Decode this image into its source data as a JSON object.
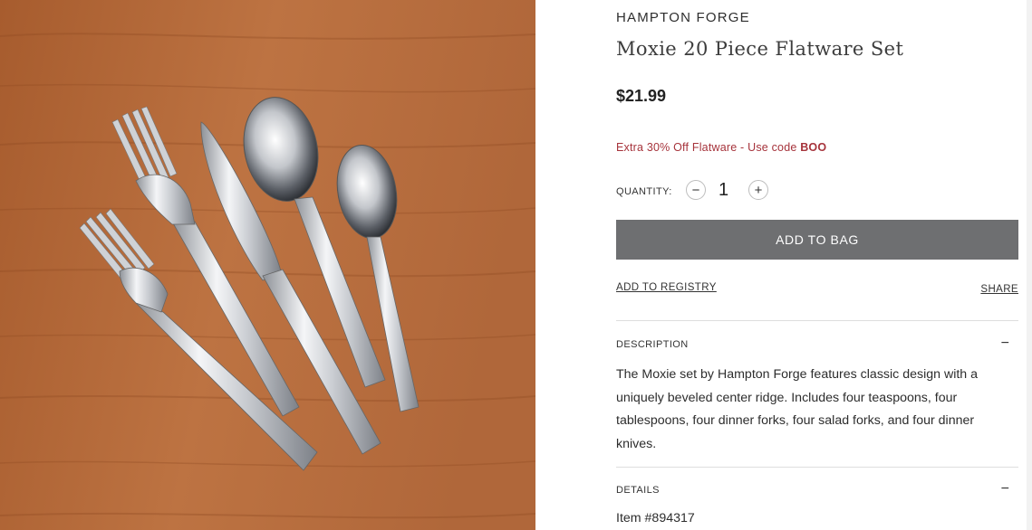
{
  "product": {
    "brand": "HAMPTON FORGE",
    "title": "Moxie 20 Piece Flatware Set",
    "price": "$21.99",
    "promo_text": "Extra 30% Off Flatware - Use code ",
    "promo_code": "BOO",
    "image_alt": "Moxie flatware set on wooden table"
  },
  "quantity": {
    "label": "QUANTITY:",
    "value": "1",
    "decrement_symbol": "−",
    "increment_symbol": "+"
  },
  "actions": {
    "add_to_bag": "ADD TO BAG",
    "add_to_registry": "ADD TO REGISTRY",
    "share": "SHARE"
  },
  "sections": {
    "description": {
      "header": "DESCRIPTION",
      "toggle": "−",
      "body": "The Moxie set by Hampton Forge features classic design with a uniquely beveled center ridge. Includes four teaspoons, four tablespoons, four dinner forks, four salad forks, and four dinner knives."
    },
    "details": {
      "header": "DETAILS",
      "toggle": "−",
      "item_number": "Item #894317"
    }
  },
  "colors": {
    "button_bg": "#6e6f71",
    "promo": "#a6333b",
    "wood": "#b5693a"
  },
  "icons": {
    "minus": "minus-icon",
    "plus": "plus-icon",
    "collapse": "collapse-minus-icon"
  }
}
